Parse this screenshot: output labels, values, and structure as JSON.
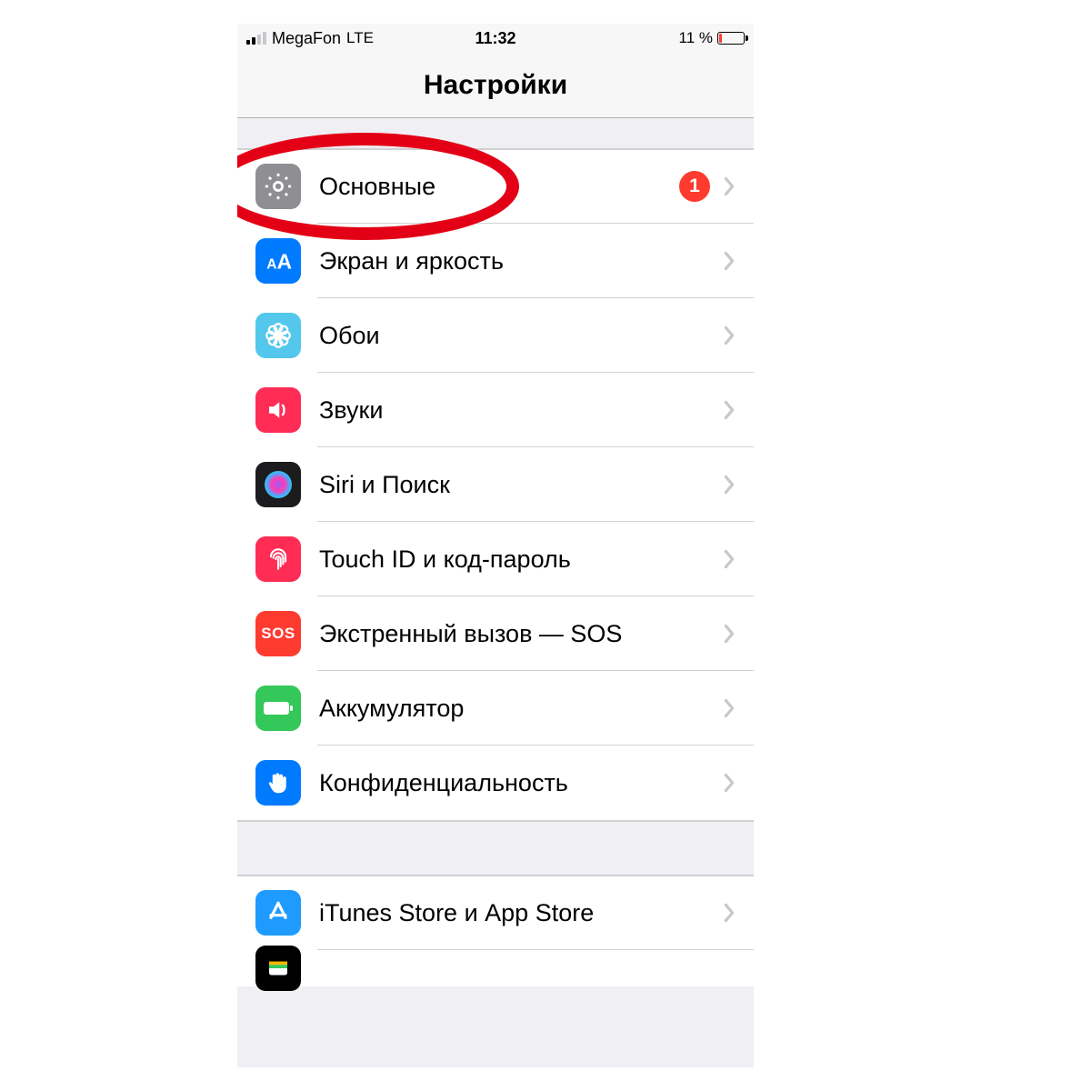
{
  "status": {
    "carrier": "MegaFon",
    "connection": "LTE",
    "time": "11:32",
    "battery_text": "11 %",
    "signal_active_bars": 2
  },
  "nav": {
    "title": "Настройки"
  },
  "groups": [
    {
      "items": [
        {
          "id": "general",
          "label": "Основные",
          "icon": "gear-icon",
          "bg": "bg-gray",
          "badge": "1"
        },
        {
          "id": "display",
          "label": "Экран и яркость",
          "icon": "text-size-icon",
          "bg": "bg-blue"
        },
        {
          "id": "wallpaper",
          "label": "Обои",
          "icon": "flower-icon",
          "bg": "bg-cyan"
        },
        {
          "id": "sounds",
          "label": "Звуки",
          "icon": "speaker-icon",
          "bg": "bg-pink"
        },
        {
          "id": "siri",
          "label": "Siri и Поиск",
          "icon": "siri-icon",
          "bg": "bg-black"
        },
        {
          "id": "touchid",
          "label": "Touch ID и код-пароль",
          "icon": "fingerprint-icon",
          "bg": "bg-pink"
        },
        {
          "id": "sos",
          "label": "Экстренный вызов — SOS",
          "icon": "sos-icon",
          "bg": "bg-red"
        },
        {
          "id": "battery",
          "label": "Аккумулятор",
          "icon": "battery-icon",
          "bg": "bg-green"
        },
        {
          "id": "privacy",
          "label": "Конфиденциальность",
          "icon": "hand-icon",
          "bg": "bg-blue"
        }
      ]
    },
    {
      "items": [
        {
          "id": "itunes",
          "label": "iTunes Store и App Store",
          "icon": "appstore-icon",
          "bg": "bg-blue2"
        }
      ]
    }
  ],
  "annotation": {
    "target_id": "general"
  }
}
